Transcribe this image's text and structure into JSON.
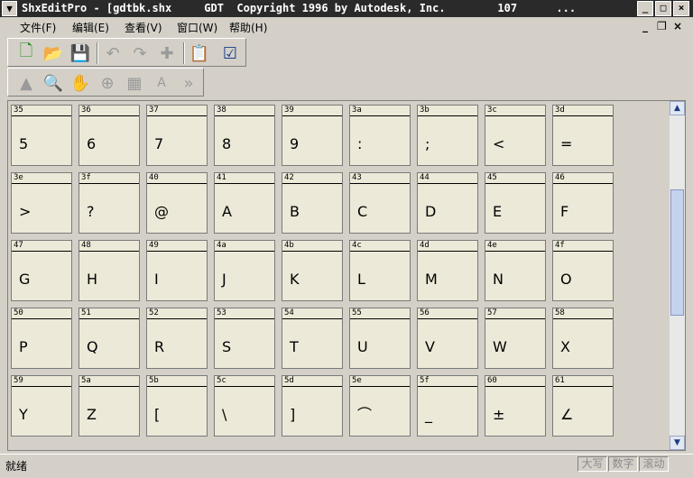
{
  "window": {
    "title": "ShxEditPro - [gdtbk.shx     GDT  Copyright 1996 by Autodesk, Inc.        107      ...",
    "sysmenu_icon": "chevron-down-icon",
    "controls": [
      "minimize-icon",
      "maximize-icon",
      "close-icon"
    ]
  },
  "menubar": {
    "items": [
      "文件(F)",
      "编辑(E)",
      "查看(V)",
      "窗口(W)",
      "帮助(H)"
    ],
    "mdi_controls": [
      "_",
      "❐",
      "×"
    ]
  },
  "toolbar1": {
    "buttons": [
      {
        "name": "new-icon",
        "glyph": "🗋"
      },
      {
        "name": "open-icon",
        "glyph": "📂"
      },
      {
        "name": "save-icon",
        "glyph": "💾"
      },
      {
        "name": "undo-icon",
        "glyph": "↶"
      },
      {
        "name": "redo-icon",
        "glyph": "↷"
      },
      {
        "name": "puzzle-icon",
        "glyph": "✚"
      },
      {
        "name": "clipboard-icon",
        "glyph": "📋"
      },
      {
        "name": "checklist-icon",
        "glyph": "☑"
      }
    ]
  },
  "toolbar2": {
    "buttons": [
      {
        "name": "pointer-icon",
        "glyph": "▲"
      },
      {
        "name": "zoom-out-icon",
        "glyph": "🔍"
      },
      {
        "name": "pan-icon",
        "glyph": "✋"
      },
      {
        "name": "zoom-in-icon",
        "glyph": "⊕"
      },
      {
        "name": "grid-icon",
        "glyph": "▦"
      },
      {
        "name": "text-icon",
        "glyph": "A"
      },
      {
        "name": "fast-forward-icon",
        "glyph": "»"
      }
    ]
  },
  "glyph_grid": {
    "rows": [
      [
        {
          "code": "35",
          "char": "5"
        },
        {
          "code": "36",
          "char": "6"
        },
        {
          "code": "37",
          "char": "7"
        },
        {
          "code": "38",
          "char": "8"
        },
        {
          "code": "39",
          "char": "9"
        },
        {
          "code": "3a",
          "char": ":"
        },
        {
          "code": "3b",
          "char": ";"
        },
        {
          "code": "3c",
          "char": "<"
        },
        {
          "code": "3d",
          "char": "="
        }
      ],
      [
        {
          "code": "3e",
          "char": ">"
        },
        {
          "code": "3f",
          "char": "?"
        },
        {
          "code": "40",
          "char": "@"
        },
        {
          "code": "41",
          "char": "A"
        },
        {
          "code": "42",
          "char": "B"
        },
        {
          "code": "43",
          "char": "C"
        },
        {
          "code": "44",
          "char": "D"
        },
        {
          "code": "45",
          "char": "E"
        },
        {
          "code": "46",
          "char": "F"
        }
      ],
      [
        {
          "code": "47",
          "char": "G"
        },
        {
          "code": "48",
          "char": "H"
        },
        {
          "code": "49",
          "char": "I"
        },
        {
          "code": "4a",
          "char": "J"
        },
        {
          "code": "4b",
          "char": "K"
        },
        {
          "code": "4c",
          "char": "L"
        },
        {
          "code": "4d",
          "char": "M"
        },
        {
          "code": "4e",
          "char": "N"
        },
        {
          "code": "4f",
          "char": "O"
        }
      ],
      [
        {
          "code": "50",
          "char": "P"
        },
        {
          "code": "51",
          "char": "Q"
        },
        {
          "code": "52",
          "char": "R"
        },
        {
          "code": "53",
          "char": "S"
        },
        {
          "code": "54",
          "char": "T"
        },
        {
          "code": "55",
          "char": "U"
        },
        {
          "code": "56",
          "char": "V"
        },
        {
          "code": "57",
          "char": "W"
        },
        {
          "code": "58",
          "char": "X"
        }
      ],
      [
        {
          "code": "59",
          "char": "Y"
        },
        {
          "code": "5a",
          "char": "Z"
        },
        {
          "code": "5b",
          "char": "["
        },
        {
          "code": "5c",
          "char": "\\"
        },
        {
          "code": "5d",
          "char": "]"
        },
        {
          "code": "5e",
          "char": "⌒"
        },
        {
          "code": "5f",
          "char": "_"
        },
        {
          "code": "60",
          "char": "±"
        },
        {
          "code": "61",
          "char": "∠"
        }
      ]
    ]
  },
  "scrollbar": {
    "up": "▲",
    "down": "▼"
  },
  "status": {
    "text": "就绪",
    "indicators": [
      "大写",
      "数字",
      "滚动"
    ]
  }
}
